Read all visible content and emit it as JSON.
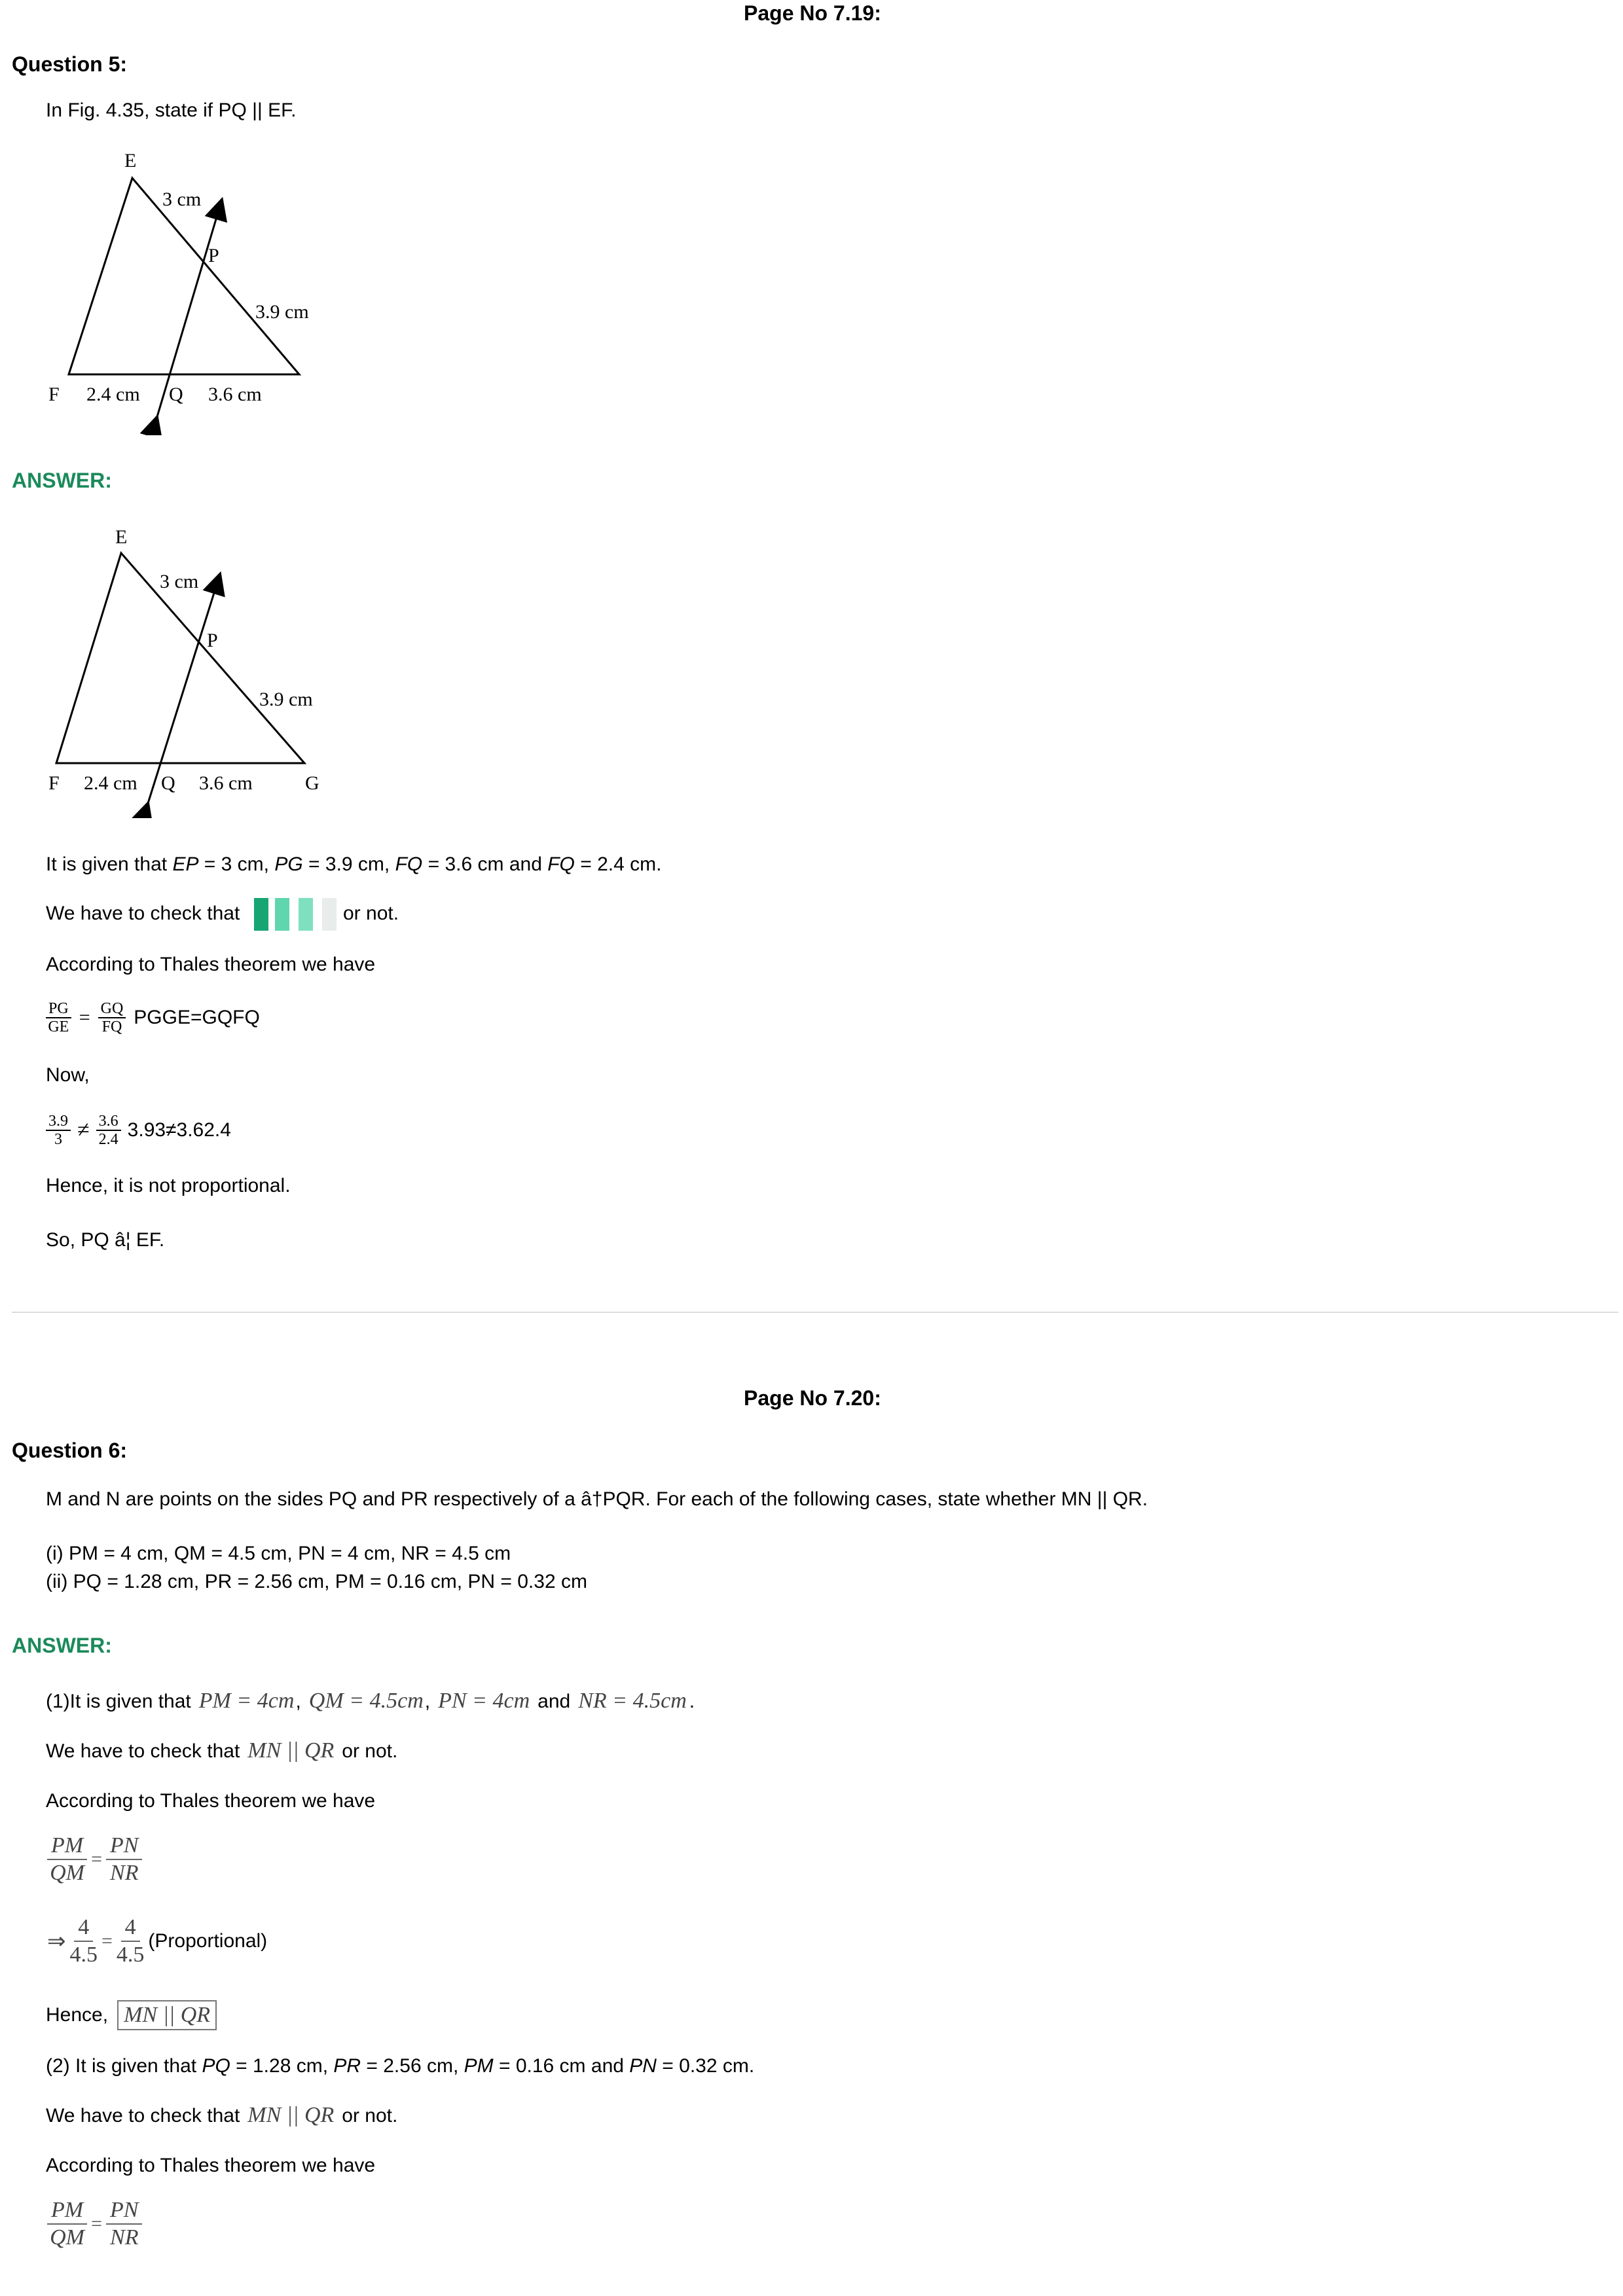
{
  "q5": {
    "page_label": "Page No 7.19:",
    "question_label": "Question 5:",
    "question_text": "In Fig. 4.35, state if PQ || EF.",
    "fig1": {
      "E": "E",
      "P": "P",
      "F": "F",
      "Q": "Q",
      "l_ep": "3 cm",
      "l_pg": "3.9 cm",
      "l_fq": "2.4 cm",
      "l_qg": "3.6 cm"
    },
    "answer_label": "ANSWER:",
    "fig2": {
      "E": "E",
      "P": "P",
      "F": "F",
      "Q": "Q",
      "G": "G",
      "l_ep": "3 cm",
      "l_pg": "3.9 cm",
      "l_fq": "2.4 cm",
      "l_qg": "3.6 cm"
    },
    "given": {
      "prefix": "It is given that ",
      "ep": "EP",
      "t1": " = 3 cm, ",
      "pg": "PG",
      "t2": " = 3.9 cm, ",
      "fq1": "FQ",
      "t3": " = 3.6 cm and ",
      "fq2": "FQ",
      "t4": " = 2.4 cm."
    },
    "check_prefix": "We have to check that ",
    "check_suffix": "or not.",
    "thales": "According to Thales theorem we have",
    "ratio": {
      "n1": "PG",
      "d1": "GE",
      "eq": "=",
      "n2": "GQ",
      "d2": "FQ",
      "text": "PGGE=GQFQ"
    },
    "now": "Now,",
    "compare": {
      "n1": "3.9",
      "d1": "3",
      "neq": "≠",
      "n2": "3.6",
      "d2": "2.4",
      "text": "3.93≠3.62.4"
    },
    "hence": "Hence, it is not proportional.",
    "conclusion": "So, PQ â¦ EF."
  },
  "q6": {
    "page_label": "Page No 7.20:",
    "question_label": "Question 6:",
    "question_text": "M and N are points on the sides PQ and PR respectively of a â†PQR. For each of the following cases, state whether MN || QR.",
    "case1": "(i) PM = 4 cm, QM = 4.5 cm, PN = 4 cm, NR = 4.5 cm",
    "case2": "(ii) PQ = 1.28 cm, PR = 2.56 cm, PM = 0.16 cm, PN = 0.32 cm",
    "answer_label": "ANSWER:",
    "p1": {
      "given_prefix": "(1)It is given that",
      "pm": "PM = 4cm",
      "qm": "QM = 4.5cm",
      "pn": "PN = 4cm",
      "and": "and",
      "nr": "NR = 4.5cm",
      "comma": ",",
      "period": ".",
      "check_prefix": "We have to check that",
      "mn_qr": "MN || QR",
      "check_suffix": "or not.",
      "thales": "According to Thales theorem we have",
      "r_n1": "PM",
      "r_d1": "QM",
      "r_eq": "=",
      "r_n2": "PN",
      "r_d2": "NR",
      "arrow": "⇒",
      "v_n1": "4",
      "v_d1": "4.5",
      "v_n2": "4",
      "v_d2": "4.5",
      "proportional": "(Proportional)",
      "hence": "Hence,"
    },
    "p2": {
      "given": {
        "prefix": "(2) It is given that ",
        "pq": "PQ",
        "t1": " = 1.28 cm, ",
        "pr": "PR",
        "t2": " = 2.56 cm, ",
        "pm": "PM",
        "t3": " = 0.16 cm and ",
        "pn": "PN",
        "t4": " = 0.32 cm."
      },
      "check_prefix": "We have to check that",
      "mn_qr": "MN || QR",
      "check_suffix": "or not.",
      "thales": "According to Thales theorem we have",
      "r_n1": "PM",
      "r_d1": "QM",
      "r_eq": "=",
      "r_n2": "PN",
      "r_d2": "NR"
    }
  },
  "colors": {
    "answer": "#1b8a5a",
    "swatch_dark": "#17a673",
    "swatch_mid": "#5fd6ae",
    "swatch_light": "#7fe0c0",
    "swatch_pale": "#e8ecea"
  }
}
